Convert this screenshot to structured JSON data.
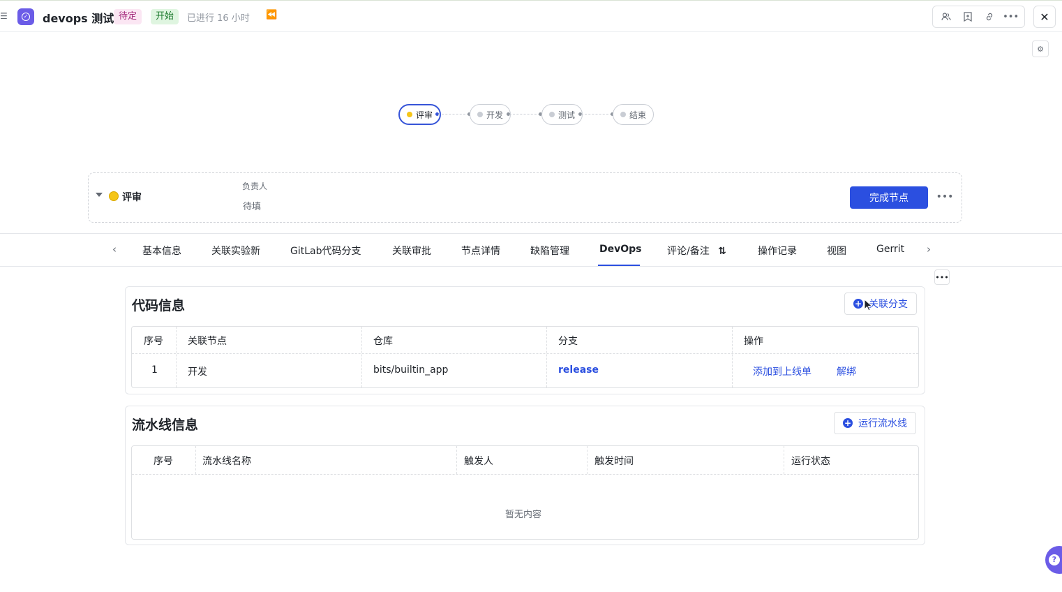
{
  "header": {
    "title": "devops 测试",
    "status_tag": "待定",
    "stage_tag": "开始",
    "elapsed": "已进行 16 小时",
    "icons": [
      "collapse-icon",
      "pin-icon",
      "members-icon",
      "bookmark-icon",
      "link-icon",
      "more-icon",
      "close-icon"
    ]
  },
  "workflow": {
    "nodes": [
      {
        "label": "评审",
        "state": "active"
      },
      {
        "label": "开发",
        "state": "pending"
      },
      {
        "label": "测试",
        "state": "pending"
      },
      {
        "label": "结束",
        "state": "pending"
      }
    ]
  },
  "node_card": {
    "name": "评审",
    "owner_label": "负责人",
    "owner_value": "待填",
    "complete_label": "完成节点"
  },
  "tabs": {
    "items": [
      "基本信息",
      "关联实验新",
      "GitLab代码分支",
      "关联审批",
      "节点详情",
      "缺陷管理",
      "DevOps",
      "评论/备注",
      "操作记录",
      "视图",
      "Gerrit"
    ],
    "active": "DevOps"
  },
  "code_section": {
    "title": "代码信息",
    "action_label": "关联分支",
    "columns": [
      "序号",
      "关联节点",
      "仓库",
      "分支",
      "操作"
    ],
    "rows": [
      {
        "index": "1",
        "node": "开发",
        "repo": "bits/builtin_app",
        "branch": "release",
        "action_add": "添加到上线单",
        "action_unbind": "解绑"
      }
    ]
  },
  "pipeline_section": {
    "title": "流水线信息",
    "action_label": "运行流水线",
    "columns": [
      "序号",
      "流水线名称",
      "触发人",
      "触发时间",
      "运行状态"
    ],
    "empty_text": "暂无内容"
  },
  "colors": {
    "primary": "#2b4fe0",
    "app_icon": "#6b5ce7",
    "active_dot": "#f5c518"
  }
}
